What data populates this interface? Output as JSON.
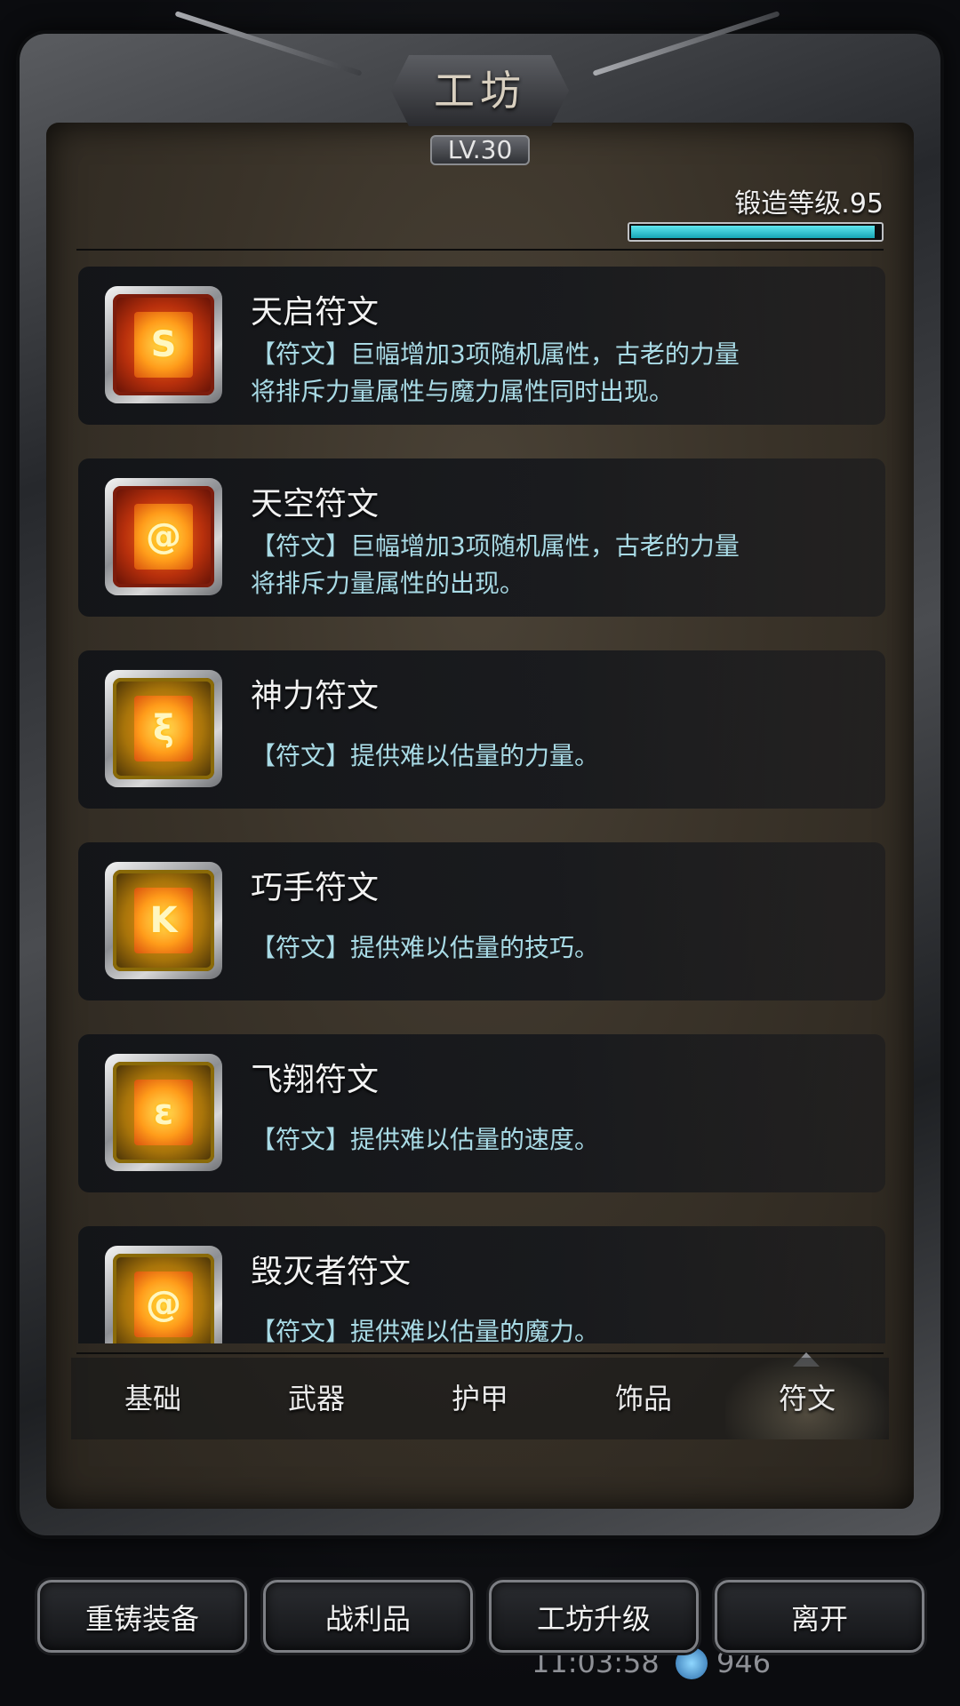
{
  "window": {
    "title": "工坊",
    "level_badge": "LV.30"
  },
  "forge": {
    "label": "锻造等级.95",
    "progress": 0.98
  },
  "runes": [
    {
      "name": "天启符文",
      "desc_lines": [
        "【符文】巨幅增加3项随机属性，古老的力量",
        "将排斥力量属性与魔力属性同时出现。"
      ],
      "rarity": "red",
      "glyph": "S"
    },
    {
      "name": "天空符文",
      "desc_lines": [
        "【符文】巨幅增加3项随机属性，古老的力量",
        "将排斥力量属性的出现。"
      ],
      "rarity": "red",
      "glyph": "@"
    },
    {
      "name": "神力符文",
      "desc_lines": [
        "【符文】提供难以估量的力量。"
      ],
      "rarity": "gold",
      "glyph": "ξ"
    },
    {
      "name": "巧手符文",
      "desc_lines": [
        "【符文】提供难以估量的技巧。"
      ],
      "rarity": "gold",
      "glyph": "K"
    },
    {
      "name": "飞翔符文",
      "desc_lines": [
        "【符文】提供难以估量的速度。"
      ],
      "rarity": "gold",
      "glyph": "ε"
    },
    {
      "name": "毁灭者符文",
      "desc_lines": [
        "【符文】提供难以估量的魔力。"
      ],
      "rarity": "gold",
      "glyph": "@"
    }
  ],
  "tabs": [
    "基础",
    "武器",
    "护甲",
    "饰品",
    "符文"
  ],
  "active_tab": 4,
  "buttons": [
    "重铸装备",
    "战利品",
    "工坊升级",
    "离开"
  ],
  "hud": {
    "time": "11:03:58",
    "gems": "946"
  }
}
